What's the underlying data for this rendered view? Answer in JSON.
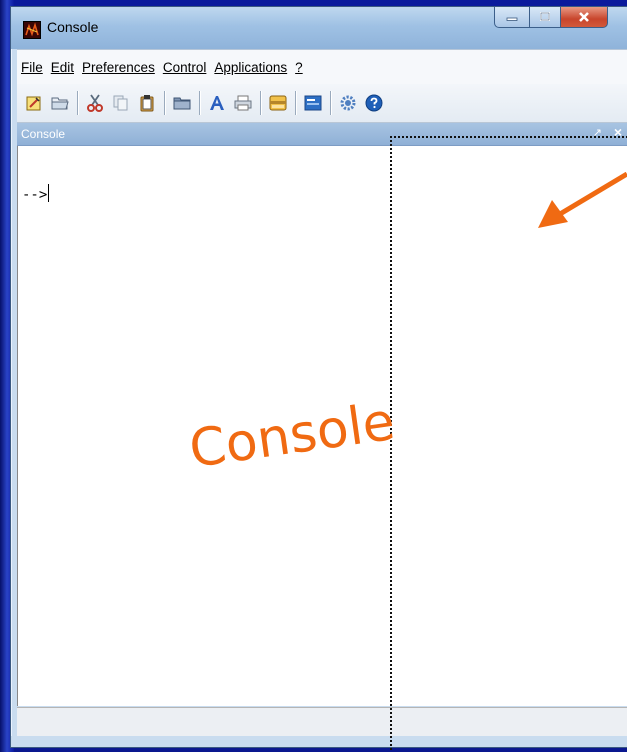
{
  "window": {
    "title": "Console"
  },
  "menu": {
    "items": [
      "File",
      "Edit",
      "Preferences",
      "Control",
      "Applications",
      "?"
    ]
  },
  "toolbar": {
    "icons": [
      "new-script-icon",
      "open-folder-icon",
      "cut-icon",
      "copy-icon",
      "paste-icon",
      "change-directory-icon",
      "font-icon",
      "print-icon",
      "variable-browser-icon",
      "scinotes-icon",
      "gear-icon",
      "help-icon"
    ]
  },
  "panel": {
    "title": "Console"
  },
  "console": {
    "prompt": "-->"
  },
  "annotation": {
    "label": "Console",
    "color": "#f06a12"
  },
  "colors": {
    "desktop": "#0b1ca6",
    "window_frame": "#c9dcef",
    "panel_header": "#9fbee0",
    "close_button": "#c8452c"
  }
}
